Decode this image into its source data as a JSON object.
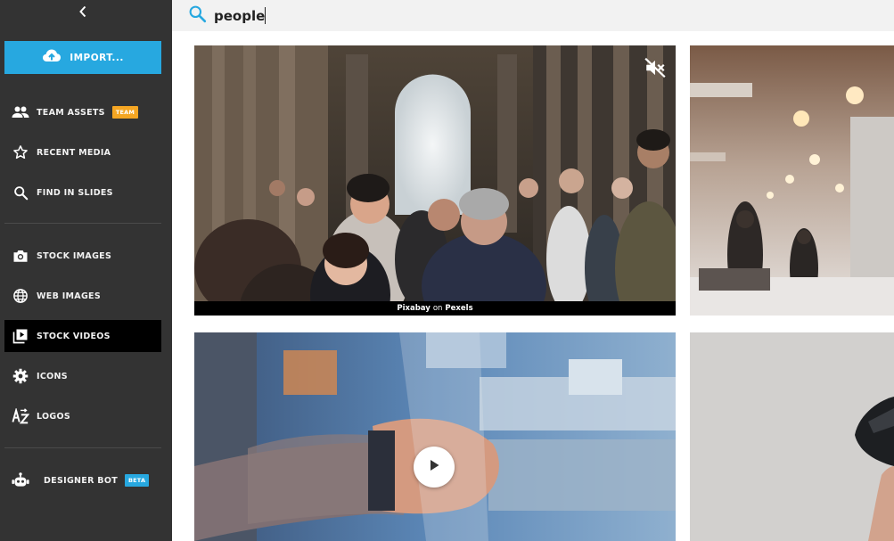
{
  "sidebar": {
    "import_label": "IMPORT...",
    "sections": [
      {
        "items": [
          {
            "id": "team-assets",
            "label": "TEAM ASSETS",
            "icon": "people-icon",
            "badge": "TEAM"
          },
          {
            "id": "recent-media",
            "label": "RECENT MEDIA",
            "icon": "star-icon"
          },
          {
            "id": "find-in-slides",
            "label": "FIND IN SLIDES",
            "icon": "search-icon"
          }
        ]
      },
      {
        "items": [
          {
            "id": "stock-images",
            "label": "STOCK IMAGES",
            "icon": "camera-icon"
          },
          {
            "id": "web-images",
            "label": "WEB IMAGES",
            "icon": "globe-icon"
          },
          {
            "id": "stock-videos",
            "label": "STOCK VIDEOS",
            "icon": "video-library-icon",
            "active": true
          },
          {
            "id": "icons",
            "label": "ICONS",
            "icon": "gear-icon"
          },
          {
            "id": "logos",
            "label": "LOGOS",
            "icon": "a-to-z-icon"
          }
        ]
      },
      {
        "items": [
          {
            "id": "designer-bot",
            "label": "DESIGNER BOT",
            "icon": "robot-icon",
            "badge": "BETA"
          }
        ]
      }
    ]
  },
  "search": {
    "query": "people",
    "icon": "search-icon"
  },
  "results": {
    "videos": [
      {
        "id": "crowd-walking",
        "credit_author": "Pixabay",
        "credit_sep": "on",
        "credit_source": "Pexels",
        "muted": true
      },
      {
        "id": "office-lights"
      },
      {
        "id": "hand-watch",
        "play": true
      },
      {
        "id": "phone-hand"
      }
    ]
  },
  "colors": {
    "sidebar_bg": "#333333",
    "accent": "#27a8e0",
    "team_badge": "#f5a623",
    "active_item": "#000000"
  }
}
